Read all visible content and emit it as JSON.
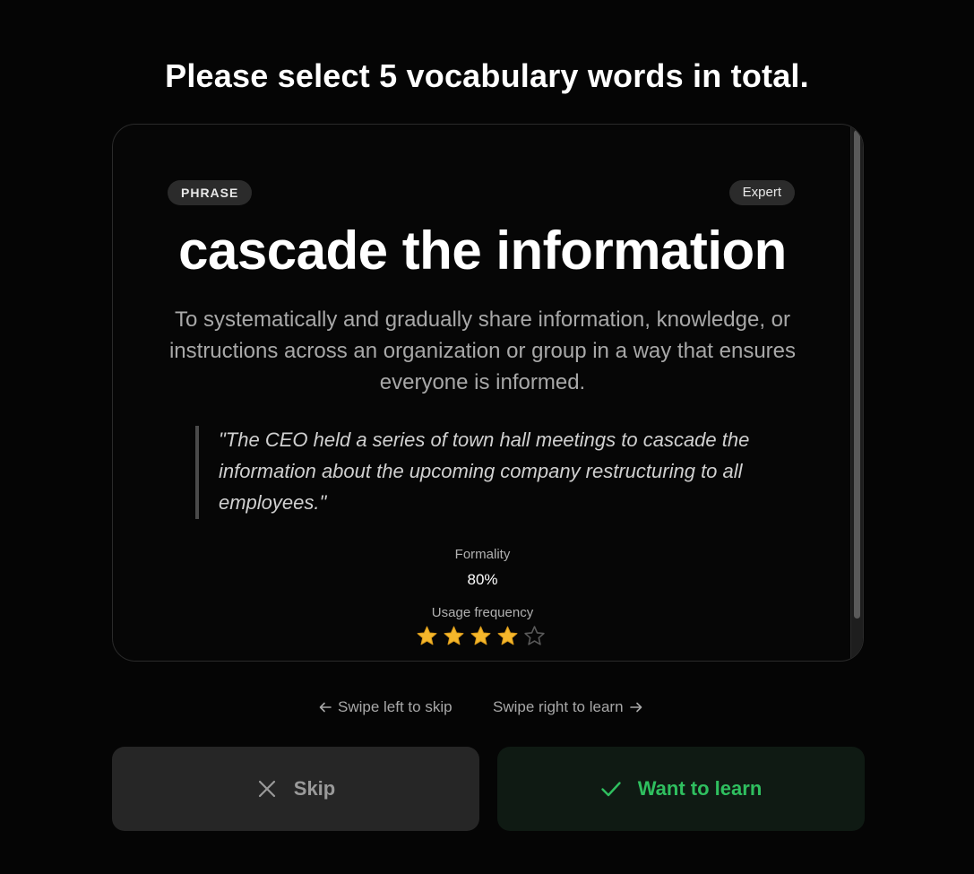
{
  "heading": "Please select 5 vocabulary words in total.",
  "card": {
    "type_badge": "PHRASE",
    "level_badge": "Expert",
    "phrase": "cascade the information",
    "definition": "To systematically and gradually share information, knowledge, or instructions across an organization or group in a way that ensures everyone is informed.",
    "example": "\"The CEO held a series of town hall meetings to cascade the information about the upcoming company restructuring to all employees.\"",
    "formality_label": "Formality",
    "formality_value": "80%",
    "frequency_label": "Usage frequency",
    "frequency_rating": 4,
    "frequency_max": 5
  },
  "hints": {
    "left": "Swipe left to skip",
    "right": "Swipe right to learn",
    "left_icon": "arrow-left-icon",
    "right_icon": "arrow-right-icon"
  },
  "buttons": {
    "skip_label": "Skip",
    "skip_icon": "close-icon",
    "learn_label": "Want to learn",
    "learn_icon": "check-icon"
  },
  "colors": {
    "background": "#050505",
    "accent_green": "#2fbf5f",
    "star_filled": "#f5b72b",
    "star_empty": "#5a5a5a"
  }
}
